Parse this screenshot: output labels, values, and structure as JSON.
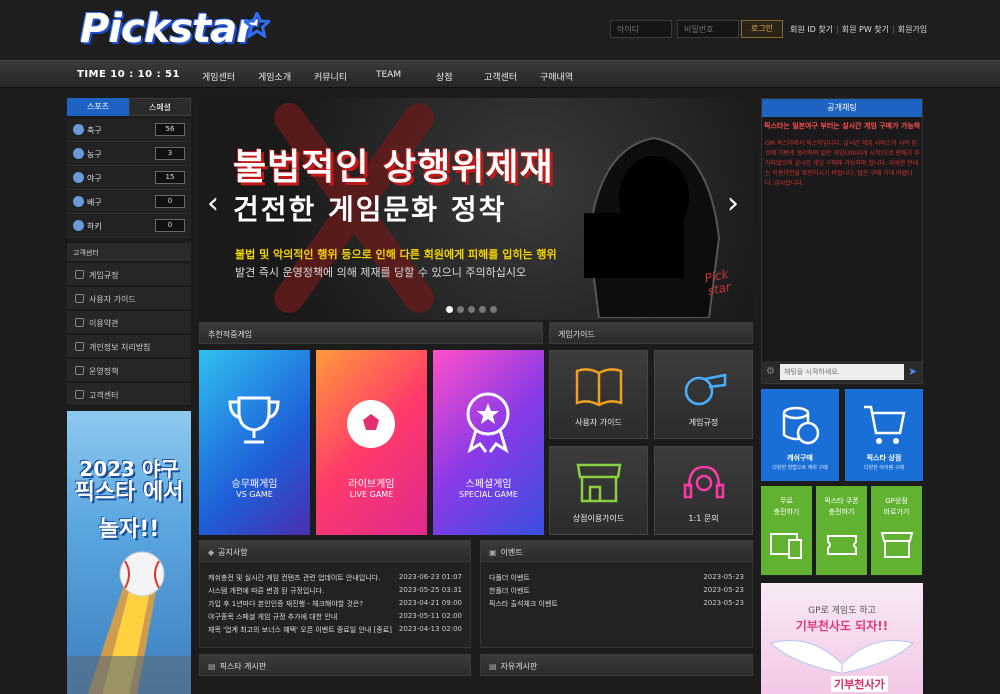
{
  "brand": {
    "logo_text": "Pickstar"
  },
  "login": {
    "id_placeholder": "아이디",
    "pw_placeholder": "비밀번호",
    "login_label": "로그인",
    "links": [
      "회원 ID 찾기",
      "회원 PW 찾기",
      "회원가입"
    ]
  },
  "nav": {
    "time": "TIME 10 : 10 : 51",
    "items": [
      "게임센터",
      "게임소개",
      "커뮤니티",
      "TEAM",
      "상점",
      "고객센터",
      "구매내역"
    ]
  },
  "sports": {
    "tabs": [
      "스포츠",
      "스페셜"
    ],
    "items": [
      {
        "name": "축구",
        "count": "56"
      },
      {
        "name": "농구",
        "count": "3"
      },
      {
        "name": "야구",
        "count": "15"
      },
      {
        "name": "배구",
        "count": "0"
      },
      {
        "name": "하키",
        "count": "0"
      }
    ]
  },
  "customer": {
    "title": "고객센터",
    "items": [
      "게임규정",
      "사용자 가이드",
      "이용약관",
      "개인정보 처리방침",
      "운영정책",
      "고객센터"
    ]
  },
  "left_banner": {
    "line1": "2023 야구",
    "line2": "픽스타 에서",
    "line3": "놀자!!"
  },
  "slider": {
    "headline1": "불법적인 상행위제재",
    "headline2": "건전한 게임문화 정착",
    "body1": "불법 및 악의적인 행위 등으로 인해 다른 회원에게 피해를 입히는 행위",
    "body2": "발견 즉시 운영정책에 의해 제재를 당할 수 있으니 주의하십시오",
    "stamp": "Pick star",
    "prev": "‹",
    "next": "›"
  },
  "recommended": {
    "title": "추천적중게임",
    "cards": [
      {
        "t1": "승무패게임",
        "t2": "VS GAME"
      },
      {
        "t1": "라이브게임",
        "t2": "LIVE GAME"
      },
      {
        "t1": "스페셜게임",
        "t2": "SPECIAL GAME"
      }
    ]
  },
  "guide": {
    "title": "게임가이드",
    "items": [
      "사용자 가이드",
      "게임규정",
      "상점이용가이드",
      "1:1 문의"
    ]
  },
  "notice": {
    "title": "공지사항",
    "rows": [
      {
        "text": "캐쉬충전 및 실시간 게임 컨텐츠 관련 업데이트 안내입니다.",
        "date": "2023-06-23 01:07"
      },
      {
        "text": "시스템 개편에 따른 변경 된 규정입니다.",
        "date": "2023-05-25 03:31"
      },
      {
        "text": "가입 후 1년마다 본인인증 재진행 - 체크해야할 것은?",
        "date": "2023-04-21 09:00"
      },
      {
        "text": "야구종목 스페셜 게임 규정 추가에 대한 안내",
        "date": "2023-05-11 02:00"
      },
      {
        "text": "재목 '업계 최고의 보너스 혜택' 오픈 이벤트 종료일 안내 [종료]",
        "date": "2023-04-13 02:00"
      }
    ]
  },
  "event": {
    "title": "이벤트",
    "rows": [
      {
        "text": "다폴더 이벤트",
        "date": "2023-05-23"
      },
      {
        "text": "한폴더 이벤트",
        "date": "2023-05-23"
      },
      {
        "text": "픽스타 출석체크 이벤트",
        "date": "2023-05-23"
      }
    ]
  },
  "boards": {
    "pickstar": "픽스타 게시판",
    "free": "자유게시판"
  },
  "chat": {
    "title": "공개채팅",
    "marquee": "픽스타는 일본야구 부터는 실시간 게임 구매가 가능하",
    "body": "GM 픽스타에서 픽스타입니다. 실시간 게임 서비스가 시작 된 것에 기쁘게 생각하며 일반 게임(3000개 시작)으로 판매가 추가되었으며 실시간 게임 구매에 가능하며 합니다. 자세한 안내는 이용약관을 확인하시기 바랍니다. 많은 구매 기대 바랍니다. 감사합니다.",
    "input_placeholder": "채팅을 시작하세요.",
    "send": "➤"
  },
  "shop": [
    {
      "name": "캐쉬구매",
      "sub": "다양한 방법으로 캐쉬 구매"
    },
    {
      "name": "픽스타 상점",
      "sub": "다양한 아이템 구매"
    }
  ],
  "green": [
    {
      "name": "무료\n충전하기"
    },
    {
      "name": "픽스타 쿠폰\n충전하기"
    },
    {
      "name": "GP상점\n바로가기"
    }
  ],
  "right_banner": {
    "line1": "GP로 게임도 하고",
    "line2": "기부천사도 되자!!",
    "line3": "기부천사가"
  },
  "colors": {
    "accent": "#1f63c2",
    "highlight": "#ff3333",
    "yellow": "#ffd500",
    "green": "#62b232"
  }
}
